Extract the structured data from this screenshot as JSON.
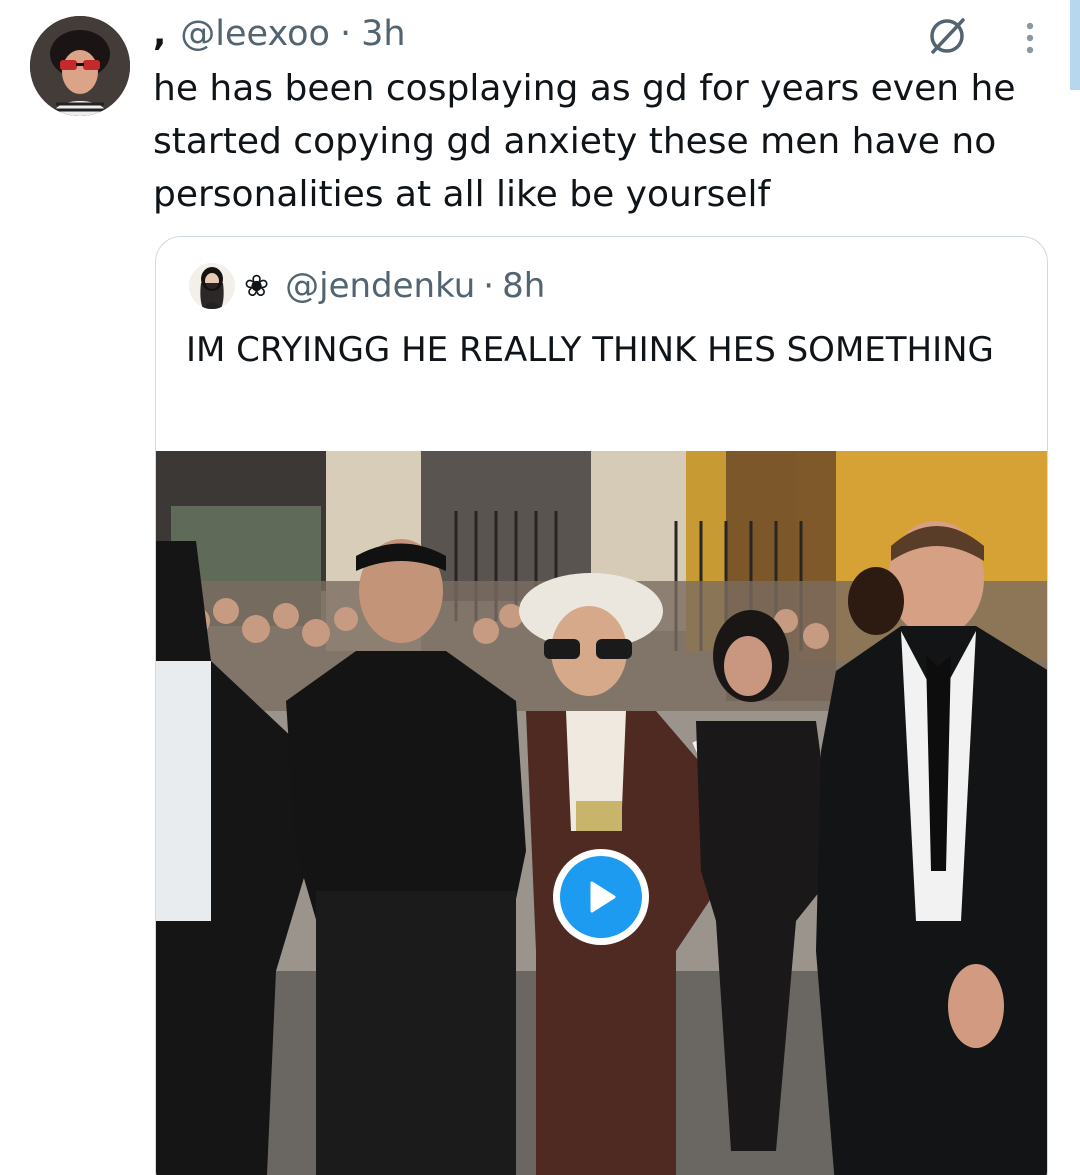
{
  "tweet": {
    "display_name": ",",
    "handle": "@leexoo",
    "separator": "·",
    "time": "3h",
    "text": "he has been cosplaying as gd for years even he started copying gd anxiety  these men have no personalities at all like be yourself"
  },
  "quoted_tweet": {
    "display_name_icon": "❀",
    "handle": "@jendenku",
    "separator": "·",
    "time": "8h",
    "text": "IM CRYINGG HE REALLY THINK HES SOMETHING",
    "media": {
      "type": "video",
      "play_icon": "play-icon"
    }
  },
  "icons": {
    "verified": "verified-ring-icon",
    "more": "more-vertical-icon"
  },
  "colors": {
    "accent": "#1d9bf0",
    "secondary_text": "#536471",
    "border": "#cfd9de"
  }
}
